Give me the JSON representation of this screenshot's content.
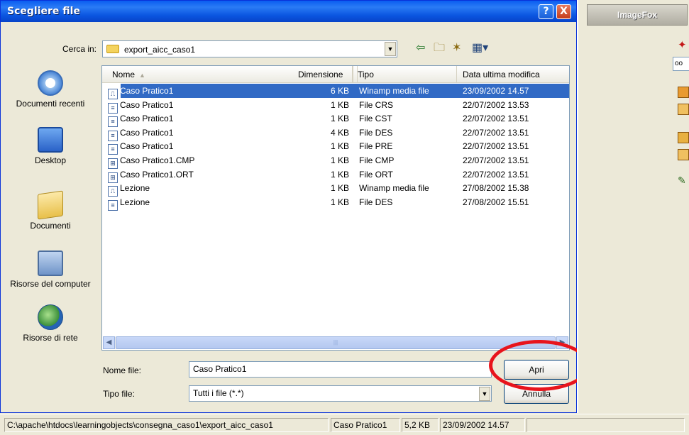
{
  "dialog": {
    "title": "Scegliere file",
    "help_glyph": "?",
    "close_glyph": "X"
  },
  "lookin": {
    "label": "Cerca in:",
    "value": "export_aicc_caso1"
  },
  "places": [
    {
      "label": "Documenti recenti",
      "icon": "recent-documents-icon"
    },
    {
      "label": "Desktop",
      "icon": "desktop-icon"
    },
    {
      "label": "Documenti",
      "icon": "documents-folder-icon"
    },
    {
      "label": "Risorse del computer",
      "icon": "my-computer-icon"
    },
    {
      "label": "Risorse di rete",
      "icon": "network-icon"
    }
  ],
  "columns": {
    "name": "Nome",
    "size": "Dimensione",
    "type": "Tipo",
    "date": "Data ultima modifica"
  },
  "files": [
    {
      "name": "Caso Pratico1",
      "size": "6 KB",
      "type": "Winamp media file",
      "date": "23/09/2002 14.57",
      "icon": "winamp-file-icon",
      "selected": true
    },
    {
      "name": "Caso Pratico1",
      "size": "1 KB",
      "type": "File CRS",
      "date": "22/07/2002 13.53",
      "icon": "generic-file-icon",
      "selected": false
    },
    {
      "name": "Caso Pratico1",
      "size": "1 KB",
      "type": "File CST",
      "date": "22/07/2002 13.51",
      "icon": "generic-file-icon",
      "selected": false
    },
    {
      "name": "Caso Pratico1",
      "size": "4 KB",
      "type": "File DES",
      "date": "22/07/2002 13.51",
      "icon": "generic-file-icon",
      "selected": false
    },
    {
      "name": "Caso Pratico1",
      "size": "1 KB",
      "type": "File PRE",
      "date": "22/07/2002 13.51",
      "icon": "generic-file-icon",
      "selected": false
    },
    {
      "name": "Caso Pratico1.CMP",
      "size": "1 KB",
      "type": "File CMP",
      "date": "22/07/2002 13.51",
      "icon": "system-file-icon",
      "selected": false
    },
    {
      "name": "Caso Pratico1.ORT",
      "size": "1 KB",
      "type": "File ORT",
      "date": "22/07/2002 13.51",
      "icon": "system-file-icon",
      "selected": false
    },
    {
      "name": "Lezione",
      "size": "1 KB",
      "type": "Winamp media file",
      "date": "27/08/2002 15.38",
      "icon": "winamp-file-icon",
      "selected": false
    },
    {
      "name": "Lezione",
      "size": "1 KB",
      "type": "File DES",
      "date": "27/08/2002 15.51",
      "icon": "generic-file-icon",
      "selected": false
    }
  ],
  "filename": {
    "label": "Nome file:",
    "value": "Caso Pratico1"
  },
  "filetype": {
    "label": "Tipo file:",
    "value": "Tutti i file (*.*)"
  },
  "buttons": {
    "open": "Apri",
    "cancel": "Annulla"
  },
  "right_app": {
    "title": "ImageFox",
    "input_text": "oo"
  },
  "statusbar": {
    "path": "C:\\apache\\htdocs\\learningobjects\\consegna_caso1\\export_aicc_caso1",
    "name": "Caso Pratico1",
    "size": "5,2 KB",
    "date": "23/09/2002 14.57"
  },
  "colors": {
    "titlebar": "#0A55E0",
    "selection": "#316AC5",
    "highlight_circle": "#E8141C"
  }
}
